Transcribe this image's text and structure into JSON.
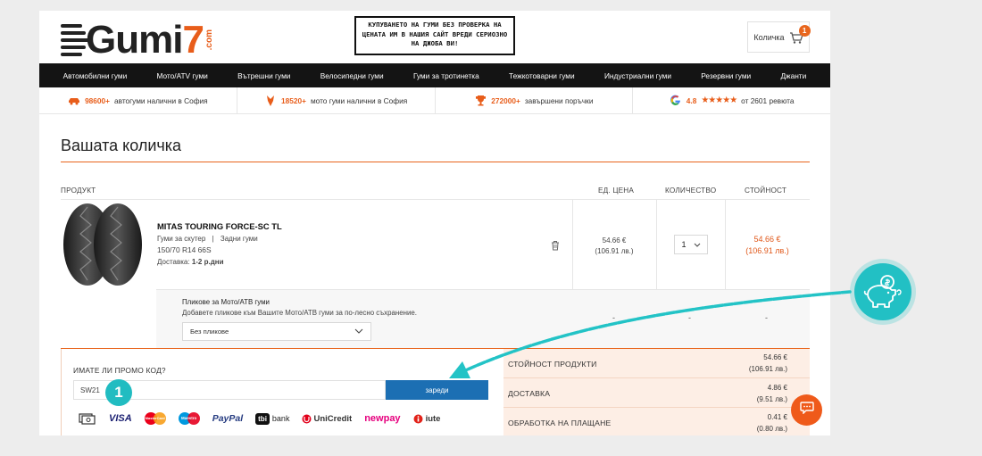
{
  "brand": {
    "logo_main": "Gumi",
    "logo_seven": "7",
    "logo_suffix": ".com"
  },
  "notice": "КУПУВАНЕТО НА ГУМИ БЕЗ ПРОВЕРКА НА ЦЕНАТА ИМ В НАШИЯ САЙТ ВРЕДИ СЕРИОЗНО НА ДЖОБА ВИ!",
  "cart": {
    "label": "Количка",
    "count": "1"
  },
  "nav": [
    "Автомобилни гуми",
    "Мото/ATV гуми",
    "Вътрешни гуми",
    "Велосипедни гуми",
    "Гуми за тротинетка",
    "Тежкотоварни гуми",
    "Индустриални гуми",
    "Резервни гуми",
    "Джанти"
  ],
  "stats": [
    {
      "strong": "98600+",
      "text": "автогуми налични в София",
      "icon": "car-icon"
    },
    {
      "strong": "18520+",
      "text": "мото гуми налични в София",
      "icon": "moto-icon"
    },
    {
      "strong": "272000+",
      "text": "завършени поръчки",
      "icon": "trophy-icon"
    },
    {
      "strong": "4.8",
      "stars": "★★★★★",
      "text": "от 2601 ревюта",
      "icon": "google-icon"
    }
  ],
  "page_title": "Вашата количка",
  "table_headers": {
    "product": "ПРОДУКТ",
    "unit_price": "ЕД. ЦЕНА",
    "quantity": "КОЛИЧЕСТВО",
    "total": "СТОЙНОСТ"
  },
  "product": {
    "name": "MITAS TOURING FORCE-SC TL",
    "category": "Гуми за скутер",
    "position": "Задни гуми",
    "size": "150/70 R14 66S",
    "delivery_label": "Доставка:",
    "delivery_value": "1-2 р.дни",
    "unit_price_eur": "54.66 €",
    "unit_price_bgn": "(106.91 лв.)",
    "quantity": "1",
    "total_eur": "54.66 €",
    "total_bgn": "(106.91 лв.)"
  },
  "bags": {
    "title": "Пликове за Мото/АТВ гуми",
    "desc": "Добавете пликове към Вашите Мото/АТВ гуми за по-лесно съхранение.",
    "select_value": "Без пликове",
    "dash": "-"
  },
  "promo": {
    "label": "ИМАТЕ ЛИ ПРОМО КОД?",
    "value": "SW21",
    "button": "зареди",
    "step": "1"
  },
  "payments": {
    "visa": "VISA",
    "mastercard": "MasterCard",
    "maestro": "Maestro",
    "paypal": "PayPal",
    "tbi": "tbi",
    "bank": "bank",
    "unicredit": "UniCredit",
    "newpay": "newpay",
    "iute": "iute"
  },
  "summary": [
    {
      "label": "СТОЙНОСТ ПРОДУКТИ",
      "eur": "54.66 €",
      "bgn": "(106.91 лв.)"
    },
    {
      "label": "ДОСТАВКА",
      "eur": "4.86 €",
      "bgn": "(9.51 лв.)"
    },
    {
      "label": "ОБРАБОТКА НА ПЛАЩАНЕ",
      "eur": "0.41 €",
      "bgn": "(0.80 лв.)"
    }
  ],
  "colors": {
    "accent": "#e8651c",
    "teal": "#22c0c4",
    "button_blue": "#1c6fb3",
    "nav_bg": "#141414",
    "summary_bg": "#fdeee5"
  }
}
